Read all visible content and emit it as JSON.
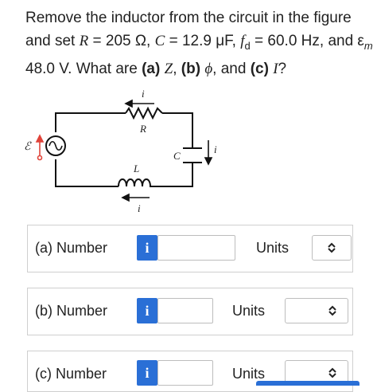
{
  "question": {
    "line1": "Remove the inductor from the circuit in the figure",
    "line2_a": "and set ",
    "line2_b": "R",
    "line2_c": " = 205 Ω, ",
    "line2_d": "C",
    "line2_e": " = 12.9 μF, ",
    "line2_f": "f",
    "line2_fsub": "d",
    "line2_g": " = 60.0 Hz, and ε",
    "line2_msub": "m",
    "line2_h": " =",
    "line3_a": "48.0 V. What are ",
    "line3_b": "(a)",
    "line3_c": " ",
    "line3_d": "Z",
    "line3_e": ", ",
    "line3_f": "(b)",
    "line3_g": " ",
    "line3_h": "ϕ",
    "line3_i": ", and ",
    "line3_j": "(c)",
    "line3_k": " ",
    "line3_l": "I",
    "line3_m": "?"
  },
  "circuit": {
    "label_i_top": "i",
    "label_R": "R",
    "label_C": "C",
    "label_i_right": "i",
    "label_L": "L",
    "label_i_bottom": "i",
    "label_source": "ℰ"
  },
  "parts": [
    {
      "label": "(a)  Number",
      "info": "i",
      "units_label": "Units"
    },
    {
      "label": "(b)  Number",
      "info": "i",
      "units_label": "Units"
    },
    {
      "label": "(c)  Number",
      "info": "i",
      "units_label": "Units"
    }
  ],
  "colors": {
    "accent": "#2a6fd6",
    "source_arrow": "#e0443a"
  },
  "icons": {
    "select": "up-down-chevron-icon",
    "info": "info-icon"
  }
}
